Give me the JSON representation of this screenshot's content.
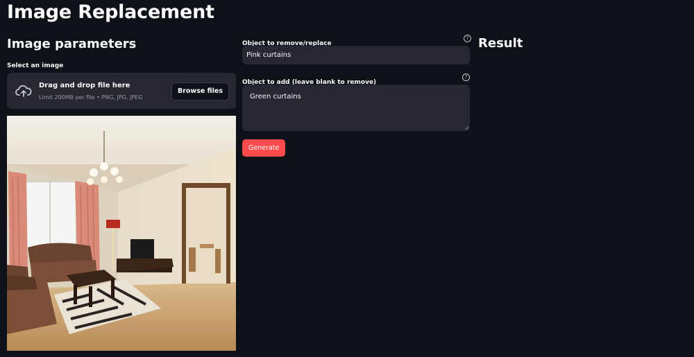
{
  "app": {
    "title": "Image Replacement"
  },
  "image_params": {
    "title": "Image parameters",
    "select_label": "Select an image",
    "uploader": {
      "title": "Drag and drop file here",
      "limit": "Limit 200MB per file • PNG, JPG, JPEG",
      "browse_label": "Browse files",
      "icon": "cloud-upload-icon"
    },
    "preview_image": "living-room-photo"
  },
  "form": {
    "remove_label": "Object to remove/replace",
    "remove_value": "Pink curtains",
    "add_label": "Object to add (leave blank to remove)",
    "add_value": "Green curtains",
    "help_icon": "?",
    "generate_label": "Generate"
  },
  "result": {
    "title": "Result"
  },
  "colors": {
    "background": "#0e1117",
    "surface": "#262730",
    "accent": "#ff4b4b",
    "text": "#fafafa"
  }
}
